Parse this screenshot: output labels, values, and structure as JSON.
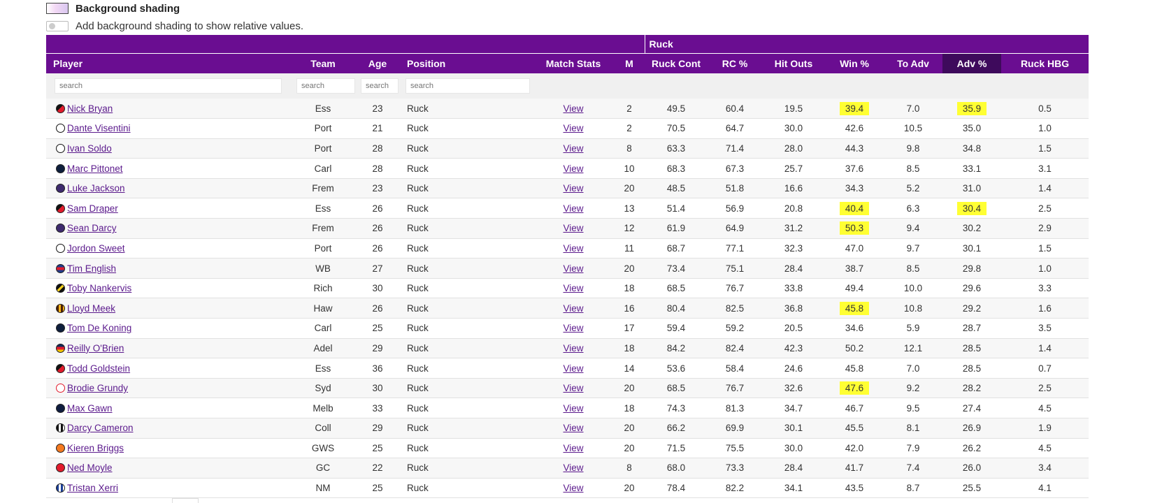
{
  "shading": {
    "title": "Background shading",
    "toggle_label": "Add background shading to show relative values."
  },
  "table": {
    "group_label": "Ruck",
    "headers": [
      "Player",
      "Team",
      "Age",
      "Position",
      "Match Stats",
      "M",
      "Ruck Cont",
      "RC %",
      "Hit Outs",
      "Win %",
      "To Adv",
      "Adv %",
      "Ruck HBG"
    ],
    "search_placeholder": "search",
    "highlight_color": "#ffff33",
    "header_color": "#6a0d91",
    "sorted_header_color": "#3e0a5c",
    "rows": [
      {
        "player": "Nick Bryan",
        "logo": "essendon-logo",
        "team": "Ess",
        "age": "23",
        "position": "Ruck",
        "match": "View",
        "m": "2",
        "rc": "49.5",
        "rcp": "60.4",
        "ho": "19.5",
        "win": "39.4",
        "toadv": "7.0",
        "adv": "35.9",
        "hbg": "0.5",
        "hl_win": true,
        "hl_adv": true
      },
      {
        "player": "Dante Visentini",
        "logo": "port-adelaide-logo",
        "team": "Port",
        "age": "21",
        "position": "Ruck",
        "match": "View",
        "m": "2",
        "rc": "70.5",
        "rcp": "64.7",
        "ho": "30.0",
        "win": "42.6",
        "toadv": "10.5",
        "adv": "35.0",
        "hbg": "1.0"
      },
      {
        "player": "Ivan Soldo",
        "logo": "port-adelaide-logo",
        "team": "Port",
        "age": "28",
        "position": "Ruck",
        "match": "View",
        "m": "8",
        "rc": "63.3",
        "rcp": "71.4",
        "ho": "28.0",
        "win": "44.3",
        "toadv": "9.8",
        "adv": "34.8",
        "hbg": "1.5"
      },
      {
        "player": "Marc Pittonet",
        "logo": "carlton-logo",
        "team": "Carl",
        "age": "28",
        "position": "Ruck",
        "match": "View",
        "m": "10",
        "rc": "68.3",
        "rcp": "67.3",
        "ho": "25.7",
        "win": "37.6",
        "toadv": "8.5",
        "adv": "33.1",
        "hbg": "3.1"
      },
      {
        "player": "Luke Jackson",
        "logo": "fremantle-logo",
        "team": "Frem",
        "age": "23",
        "position": "Ruck",
        "match": "View",
        "m": "20",
        "rc": "48.5",
        "rcp": "51.8",
        "ho": "16.6",
        "win": "34.3",
        "toadv": "5.2",
        "adv": "31.0",
        "hbg": "1.4"
      },
      {
        "player": "Sam Draper",
        "logo": "essendon-logo",
        "team": "Ess",
        "age": "26",
        "position": "Ruck",
        "match": "View",
        "m": "13",
        "rc": "51.4",
        "rcp": "56.9",
        "ho": "20.8",
        "win": "40.4",
        "toadv": "6.3",
        "adv": "30.4",
        "hbg": "2.5",
        "hl_win": true,
        "hl_adv": true
      },
      {
        "player": "Sean Darcy",
        "logo": "fremantle-logo",
        "team": "Frem",
        "age": "26",
        "position": "Ruck",
        "match": "View",
        "m": "12",
        "rc": "61.9",
        "rcp": "64.9",
        "ho": "31.2",
        "win": "50.3",
        "toadv": "9.4",
        "adv": "30.2",
        "hbg": "2.9",
        "hl_win": true
      },
      {
        "player": "Jordon Sweet",
        "logo": "port-adelaide-logo",
        "team": "Port",
        "age": "26",
        "position": "Ruck",
        "match": "View",
        "m": "11",
        "rc": "68.7",
        "rcp": "77.1",
        "ho": "32.3",
        "win": "47.0",
        "toadv": "9.7",
        "adv": "30.1",
        "hbg": "1.5"
      },
      {
        "player": "Tim English",
        "logo": "western-bulldogs-logo",
        "team": "WB",
        "age": "27",
        "position": "Ruck",
        "match": "View",
        "m": "20",
        "rc": "73.4",
        "rcp": "75.1",
        "ho": "28.4",
        "win": "38.7",
        "toadv": "8.5",
        "adv": "29.8",
        "hbg": "1.0"
      },
      {
        "player": "Toby Nankervis",
        "logo": "richmond-logo",
        "team": "Rich",
        "age": "30",
        "position": "Ruck",
        "match": "View",
        "m": "18",
        "rc": "68.5",
        "rcp": "76.7",
        "ho": "33.8",
        "win": "49.4",
        "toadv": "10.0",
        "adv": "29.6",
        "hbg": "3.3"
      },
      {
        "player": "Lloyd Meek",
        "logo": "hawthorn-logo",
        "team": "Haw",
        "age": "26",
        "position": "Ruck",
        "match": "View",
        "m": "16",
        "rc": "80.4",
        "rcp": "82.5",
        "ho": "36.8",
        "win": "45.8",
        "toadv": "10.8",
        "adv": "29.2",
        "hbg": "1.6",
        "hl_win": true
      },
      {
        "player": "Tom De Koning",
        "logo": "carlton-logo",
        "team": "Carl",
        "age": "25",
        "position": "Ruck",
        "match": "View",
        "m": "17",
        "rc": "59.4",
        "rcp": "59.2",
        "ho": "20.5",
        "win": "34.6",
        "toadv": "5.9",
        "adv": "28.7",
        "hbg": "3.5"
      },
      {
        "player": "Reilly O'Brien",
        "logo": "adelaide-logo",
        "team": "Adel",
        "age": "29",
        "position": "Ruck",
        "match": "View",
        "m": "18",
        "rc": "84.2",
        "rcp": "82.4",
        "ho": "42.3",
        "win": "50.2",
        "toadv": "12.1",
        "adv": "28.5",
        "hbg": "1.4"
      },
      {
        "player": "Todd Goldstein",
        "logo": "essendon-logo",
        "team": "Ess",
        "age": "36",
        "position": "Ruck",
        "match": "View",
        "m": "14",
        "rc": "53.6",
        "rcp": "58.4",
        "ho": "24.6",
        "win": "45.8",
        "toadv": "7.0",
        "adv": "28.5",
        "hbg": "0.7"
      },
      {
        "player": "Brodie Grundy",
        "logo": "sydney-logo",
        "team": "Syd",
        "age": "30",
        "position": "Ruck",
        "match": "View",
        "m": "20",
        "rc": "68.5",
        "rcp": "76.7",
        "ho": "32.6",
        "win": "47.6",
        "toadv": "9.2",
        "adv": "28.2",
        "hbg": "2.5",
        "hl_win": true
      },
      {
        "player": "Max Gawn",
        "logo": "melbourne-logo",
        "team": "Melb",
        "age": "33",
        "position": "Ruck",
        "match": "View",
        "m": "18",
        "rc": "74.3",
        "rcp": "81.3",
        "ho": "34.7",
        "win": "46.7",
        "toadv": "9.5",
        "adv": "27.4",
        "hbg": "4.5"
      },
      {
        "player": "Darcy Cameron",
        "logo": "collingwood-logo",
        "team": "Coll",
        "age": "29",
        "position": "Ruck",
        "match": "View",
        "m": "20",
        "rc": "66.2",
        "rcp": "69.9",
        "ho": "30.1",
        "win": "45.5",
        "toadv": "8.1",
        "adv": "26.9",
        "hbg": "1.9"
      },
      {
        "player": "Kieren Briggs",
        "logo": "gws-logo",
        "team": "GWS",
        "age": "25",
        "position": "Ruck",
        "match": "View",
        "m": "20",
        "rc": "71.5",
        "rcp": "75.5",
        "ho": "30.0",
        "win": "42.0",
        "toadv": "7.9",
        "adv": "26.2",
        "hbg": "4.5"
      },
      {
        "player": "Ned Moyle",
        "logo": "gold-coast-logo",
        "team": "GC",
        "age": "22",
        "position": "Ruck",
        "match": "View",
        "m": "8",
        "rc": "68.0",
        "rcp": "73.3",
        "ho": "28.4",
        "win": "41.7",
        "toadv": "7.4",
        "adv": "26.0",
        "hbg": "3.4"
      },
      {
        "player": "Tristan Xerri",
        "logo": "north-melbourne-logo",
        "team": "NM",
        "age": "25",
        "position": "Ruck",
        "match": "View",
        "m": "20",
        "rc": "78.4",
        "rcp": "82.2",
        "ho": "34.1",
        "win": "43.5",
        "toadv": "8.7",
        "adv": "25.5",
        "hbg": "4.1"
      }
    ]
  }
}
